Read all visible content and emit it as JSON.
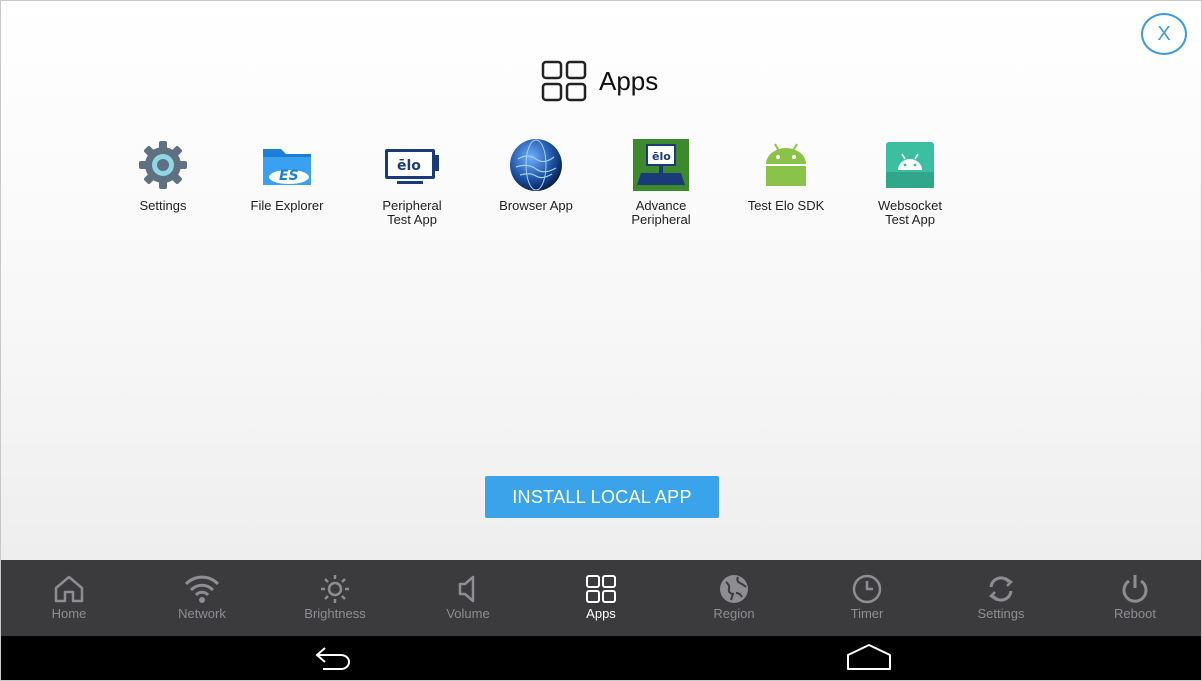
{
  "header": {
    "title": "Apps",
    "close_label": "X"
  },
  "apps": [
    {
      "label": "Settings",
      "icon": "gear-icon"
    },
    {
      "label": "File Explorer",
      "icon": "es-file-explorer-icon"
    },
    {
      "label": "Peripheral\nTest App",
      "icon": "elo-monitor-icon"
    },
    {
      "label": "Browser App",
      "icon": "globe-icon"
    },
    {
      "label": "Advance\nPeripheral",
      "icon": "elo-terminal-icon"
    },
    {
      "label": "Test Elo SDK",
      "icon": "android-icon"
    },
    {
      "label": "Websocket\nTest App",
      "icon": "android-tile-icon"
    }
  ],
  "install_button": "INSTALL LOCAL APP",
  "elo_logo_text": "ēlo",
  "es_logo_text": "ES",
  "nav": [
    {
      "label": "Home",
      "icon": "home-icon"
    },
    {
      "label": "Network",
      "icon": "wifi-icon"
    },
    {
      "label": "Brightness",
      "icon": "sun-icon"
    },
    {
      "label": "Volume",
      "icon": "speaker-icon"
    },
    {
      "label": "Apps",
      "icon": "apps-grid-icon",
      "active": true
    },
    {
      "label": "Region",
      "icon": "globe-icon"
    },
    {
      "label": "Timer",
      "icon": "clock-icon"
    },
    {
      "label": "Settings",
      "icon": "refresh-icon"
    },
    {
      "label": "Reboot",
      "icon": "power-icon"
    }
  ],
  "colors": {
    "accent": "#3aa3ea",
    "navbar": "#3b3b3e",
    "nav_inactive": "#8e8e92",
    "nav_active": "#ffffff"
  }
}
